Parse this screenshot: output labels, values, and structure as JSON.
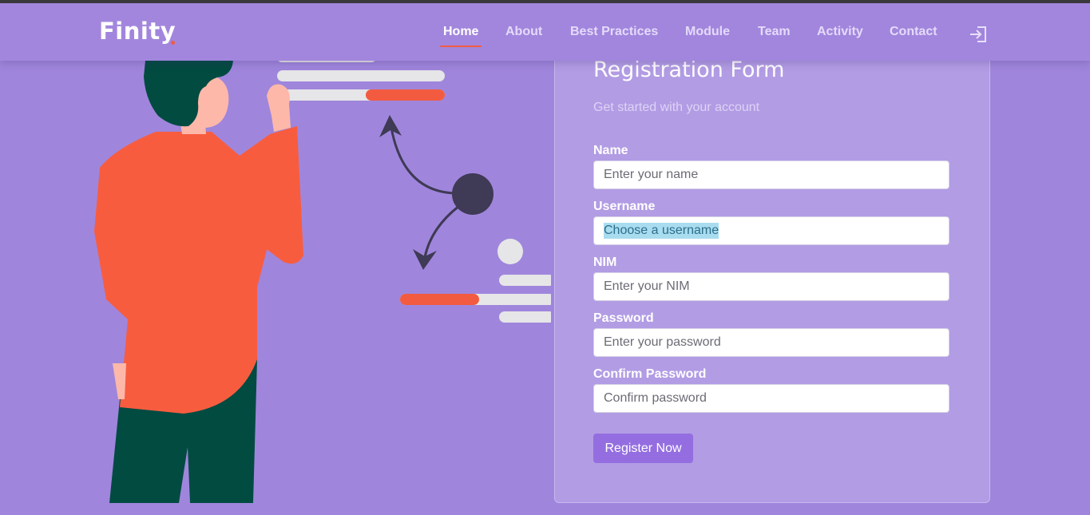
{
  "brand": {
    "name": "Finity"
  },
  "nav": {
    "items": [
      {
        "label": "Home",
        "active": true
      },
      {
        "label": "About",
        "active": false
      },
      {
        "label": "Best Practices",
        "active": false
      },
      {
        "label": "Module",
        "active": false
      },
      {
        "label": "Team",
        "active": false
      },
      {
        "label": "Activity",
        "active": false
      },
      {
        "label": "Contact",
        "active": false
      }
    ],
    "login_icon": "login-icon"
  },
  "form": {
    "title": "Registration Form",
    "subtitle": "Get started with your account",
    "fields": [
      {
        "label": "Name",
        "placeholder": "Enter your name",
        "value": ""
      },
      {
        "label": "Username",
        "placeholder": "Choose a username",
        "value": "",
        "text_selected": true
      },
      {
        "label": "NIM",
        "placeholder": "Enter your NIM",
        "value": ""
      },
      {
        "label": "Password",
        "placeholder": "Enter your password",
        "value": ""
      },
      {
        "label": "Confirm Password",
        "placeholder": "Confirm password",
        "value": ""
      }
    ],
    "submit_label": "Register Now"
  },
  "colors": {
    "background": "#9f86dc",
    "navbar": "#a286dd",
    "card": "#b29ce4",
    "accent": "#f25b3f",
    "button": "#946ee0",
    "selection": "#a9dcef"
  }
}
